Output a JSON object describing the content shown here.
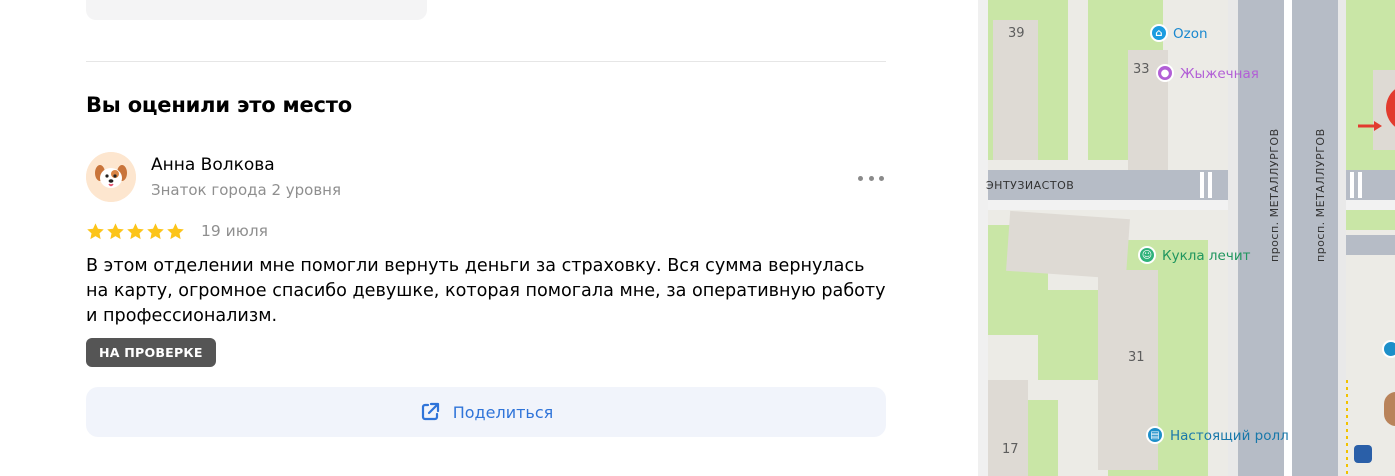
{
  "section": {
    "title": "Вы оценили это место"
  },
  "review": {
    "author_name": "Анна Волкова",
    "author_level": "Знаток города 2 уровня",
    "rating": 5,
    "date": "19 июля",
    "text": "В этом отделении мне помогли вернуть деньги за страховку. Вся сумма вернулась на карту, огромное спасибо девушке, которая помогала мне, за оперативную работу и профессионализм.",
    "status": "НА ПРОВЕРКЕ",
    "more_icon": "more-dots-icon",
    "star_color": "#fcc419"
  },
  "share": {
    "label": "Поделиться",
    "icon": "external-share-icon",
    "color": "#2f74d9"
  },
  "map": {
    "buildings": [
      "39",
      "33",
      "31",
      "17"
    ],
    "pois": [
      {
        "name": "Ozon",
        "icon": "shopping-bag-icon",
        "color": "#1a9ce0"
      },
      {
        "name": "Жыжечная",
        "icon": "restaurant-icon",
        "color": "#b25fd6"
      },
      {
        "name": "Кукла лечит",
        "icon": "toy-icon",
        "color": "#2fb27a"
      },
      {
        "name": "Настоящий ролл",
        "icon": "basket-icon",
        "color": "#1d8fc9"
      }
    ],
    "streets": [
      "ЭНТУЗИАСТОВ",
      "просп. МЕТАЛЛУРГОВ",
      "просп. МЕТАЛЛУРГОВ"
    ]
  }
}
